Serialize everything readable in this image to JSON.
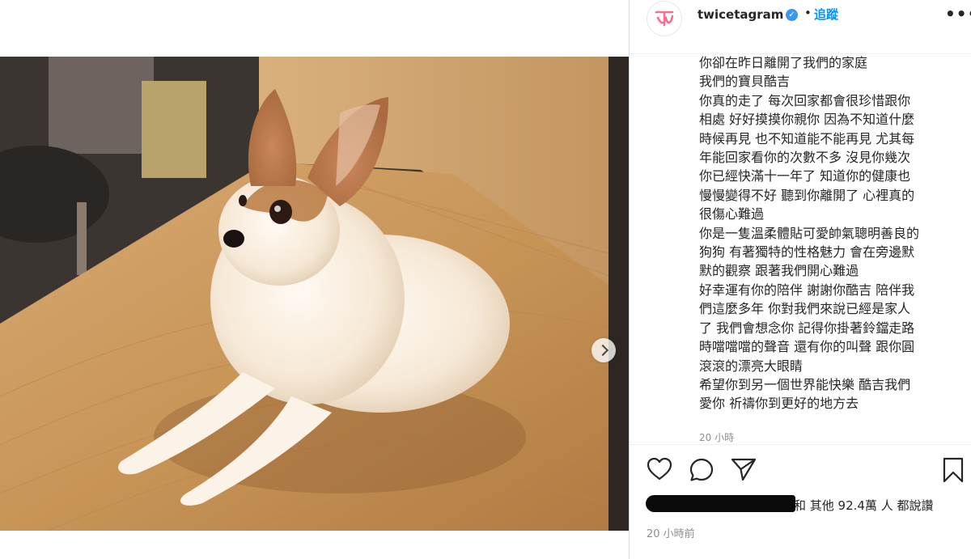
{
  "post": {
    "username": "twicetagram",
    "verified_icon": "✓",
    "separator": "•",
    "follow_label": "追蹤",
    "more_label": "•••",
    "avatar_text": "TWICE",
    "caption_lines": [
      "你卻在昨日離開了我們的家庭",
      "我們的寶貝酷吉",
      "你真的走了 每次回家都會很珍惜跟你",
      "相處 好好摸摸你親你 因為不知道什麼",
      "時候再見 也不知道能不能再見 尤其每",
      "年能回家看你的次數不多 沒見你幾次",
      "你已經快滿十一年了 知道你的健康也",
      "慢慢變得不好 聽到你離開了 心裡真的",
      "很傷心難過",
      "你是一隻溫柔體貼可愛帥氣聰明善良的",
      "狗狗 有著獨特的性格魅力 會在旁邊默",
      "默的觀察 跟著我們開心難過",
      "好幸運有你的陪伴 謝謝你酷吉 陪伴我",
      "們這麼多年 你對我們來說已經是家人",
      "了 我們會想念你 記得你掛著鈴鐺走路",
      "時噹噹噹的聲音 還有你的叫聲 跟你圓",
      "滾滾的漂亮大眼睛",
      "希望你到另一個世界能快樂 酷吉我們",
      "愛你 祈禱你到更好的地方去"
    ],
    "caption_time": "20 小時",
    "likes_text": "和 其他 92.4萬 人 都說讚",
    "post_time": "20 小時前"
  },
  "icons": {
    "like": "heart-icon",
    "comment": "comment-icon",
    "share": "paper-plane-icon",
    "save": "bookmark-icon",
    "next": "chevron-right-icon"
  },
  "colors": {
    "accent": "#0095f6",
    "verified": "#3897f0",
    "muted": "#8e8e8e",
    "brand": "#fb6c8f"
  }
}
